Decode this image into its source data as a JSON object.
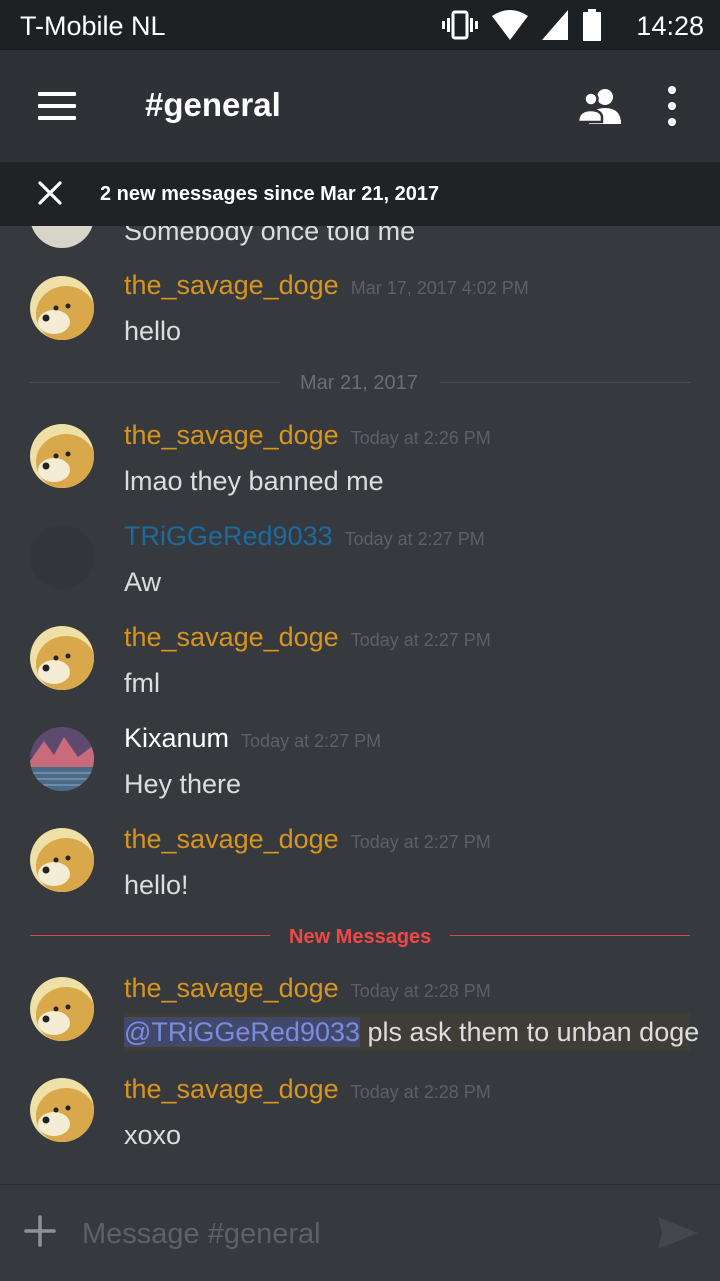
{
  "status_bar": {
    "carrier": "T-Mobile  NL",
    "time": "14:28",
    "icons": [
      "vibrate-icon",
      "wifi-icon",
      "signal-icon",
      "battery-icon"
    ]
  },
  "app_bar": {
    "channel": "#general",
    "icons": [
      "menu-icon",
      "members-icon",
      "more-icon"
    ]
  },
  "banner": {
    "text": "2 new messages since Mar 21, 2017"
  },
  "messages": {
    "partial_text": "Somebody once told me",
    "m1": {
      "author": "the_savage_doge",
      "time": "Mar 17, 2017 4:02 PM",
      "text": "hello"
    },
    "divider_date": "Mar 21, 2017",
    "m2": {
      "author": "the_savage_doge",
      "time": "Today at 2:26 PM",
      "text": "lmao they banned me"
    },
    "m3": {
      "author": "TRiGGeRed9033",
      "time": "Today at 2:27 PM",
      "text": "Aw"
    },
    "m4": {
      "author": "the_savage_doge",
      "time": "Today at 2:27 PM",
      "text": "fml"
    },
    "m5": {
      "author": "Kixanum",
      "time": "Today at 2:27 PM",
      "text": "Hey there"
    },
    "m6": {
      "author": "the_savage_doge",
      "time": "Today at 2:27 PM",
      "text": "hello!"
    },
    "divider_new": "New Messages",
    "m7": {
      "author": "the_savage_doge",
      "time": "Today at 2:28 PM",
      "mention": "@TRiGGeRed9033",
      "text": " pls ask them to unban doge"
    },
    "m8": {
      "author": "the_savage_doge",
      "time": "Today at 2:28 PM",
      "text": "xoxo"
    }
  },
  "composer": {
    "placeholder": "Message #general"
  },
  "colors": {
    "background": "#36393e",
    "header": "#2f3136",
    "doge_name": "#d8951e",
    "trigger_name": "#1c6a9f",
    "new_messages": "#f04747",
    "mention": "#7b8be0"
  }
}
